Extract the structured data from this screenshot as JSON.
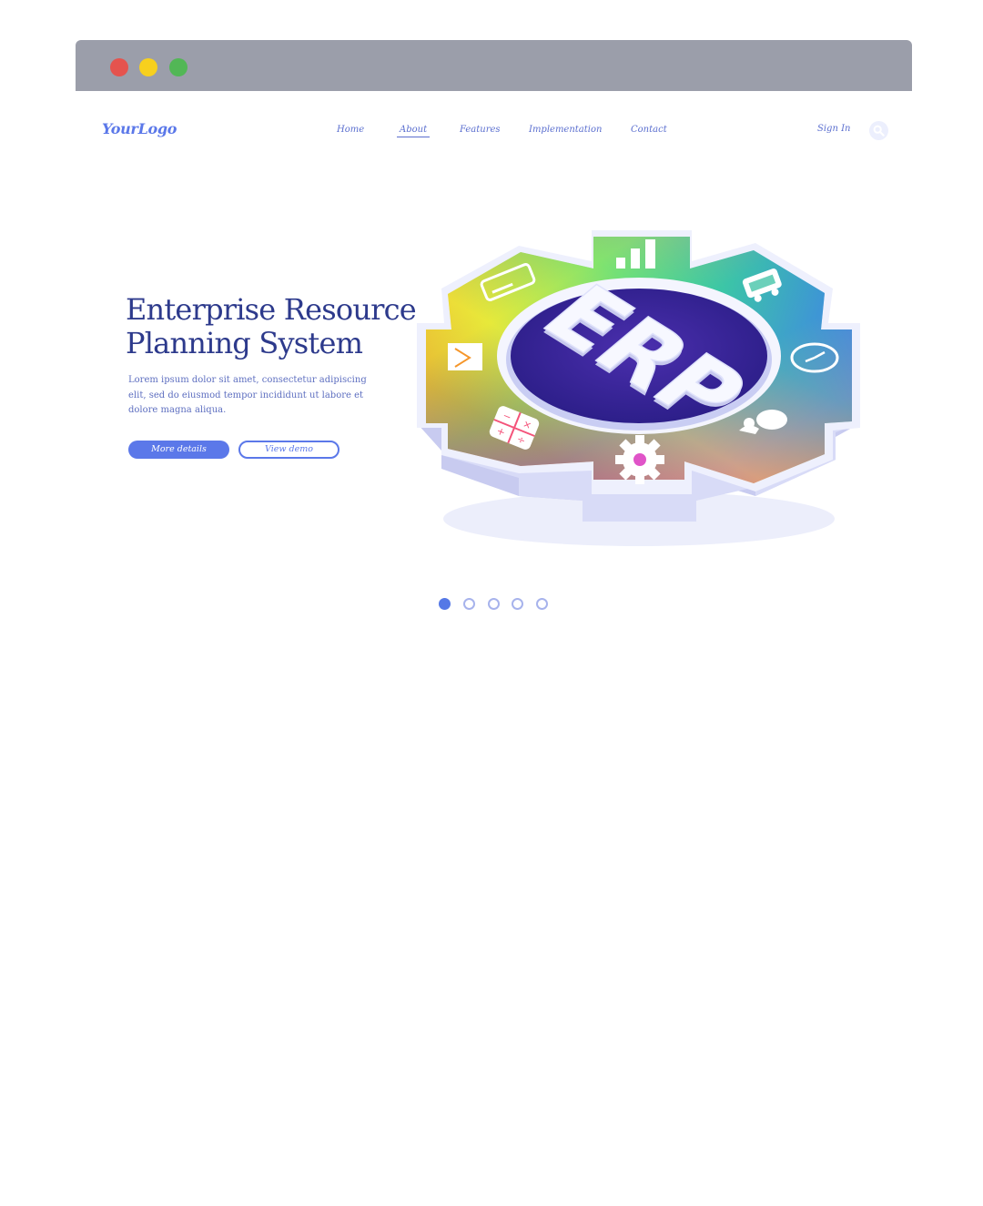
{
  "colors": {
    "brand_blue": "#5b78e9",
    "title_navy": "#2d3a8c",
    "nav_text": "#5b6fcf",
    "body_text": "#5e6fc0",
    "window_bar": "#9b9eaa",
    "traffic_red": "#e5534e",
    "traffic_yellow": "#f7d01e",
    "traffic_green": "#52b756",
    "pager_active": "#5578e6",
    "pager_inactive": "#a7b3ec"
  },
  "window": {
    "controls": [
      "close-icon",
      "minimize-icon",
      "maximize-icon"
    ]
  },
  "header": {
    "logo": "YourLogo",
    "nav": [
      {
        "label": "Home",
        "active": false
      },
      {
        "label": "About",
        "active": true
      },
      {
        "label": "Features",
        "active": false
      },
      {
        "label": "Implementation",
        "active": false
      },
      {
        "label": "Contact",
        "active": false
      }
    ],
    "sign_in": "Sign In",
    "search_icon": "search-icon"
  },
  "hero": {
    "title_line1": "Enterprise Resource",
    "title_line2": "Planning System",
    "description": "Lorem ipsum dolor sit amet, consectetur adipiscing elit, sed do eiusmod tempor incididunt ut labore et dolore magna aliqua.",
    "primary_button": "More details",
    "secondary_button": "View demo",
    "illustration": {
      "center_text": "ERP",
      "icons": [
        "credit-card-icon",
        "bar-chart-icon",
        "truck-icon",
        "clock-icon",
        "people-icon",
        "gear-icon",
        "calculator-icon",
        "mail-icon"
      ]
    }
  },
  "carousel": {
    "total": 5,
    "active_index": 0
  }
}
